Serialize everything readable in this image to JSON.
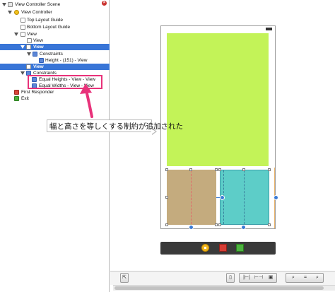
{
  "outline": {
    "items": [
      {
        "label": "View Controller Scene",
        "icon": "scene-icon"
      },
      {
        "label": "View Controller",
        "icon": "view-controller-icon"
      },
      {
        "label": "Top Layout Guide",
        "icon": "layout-guide-icon"
      },
      {
        "label": "Bottom Layout Guide",
        "icon": "layout-guide-icon"
      },
      {
        "label": "View",
        "icon": "view-icon"
      },
      {
        "label": "View",
        "icon": "view-icon"
      },
      {
        "label": "View",
        "icon": "view-icon"
      },
      {
        "label": "Constraints",
        "icon": "constraints-icon"
      },
      {
        "label": "Height - (151) - View",
        "icon": "constraint-icon"
      },
      {
        "label": "View",
        "icon": "view-icon"
      },
      {
        "label": "Constraints",
        "icon": "constraints-icon"
      },
      {
        "label": "Equal Heights - View - View",
        "icon": "constraint-icon"
      },
      {
        "label": "Equal Widths - View - View",
        "icon": "constraint-icon"
      },
      {
        "label": "First Responder",
        "icon": "first-responder-icon"
      },
      {
        "label": "Exit",
        "icon": "exit-icon"
      }
    ]
  },
  "annotation": {
    "text": "幅と高さを等しくする制約が追加された",
    "highlight_color": "#e8327a"
  },
  "toolbar": {
    "btn1": "⇱",
    "btn2": "▯",
    "btn3": "|⊢|",
    "btn4": "⊢⊣",
    "btn5": "▣",
    "btn6": "⌕",
    "btn7": "=",
    "btn8": "⌕"
  },
  "colors": {
    "selection": "#3875d7",
    "green_view": "#c3f358",
    "tan_view": "#c4ab7e",
    "teal_view": "#5dcdc8"
  }
}
